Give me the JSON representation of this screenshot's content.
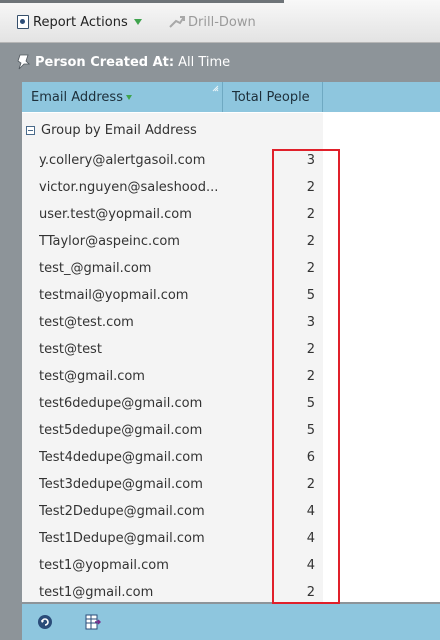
{
  "toolbar": {
    "report_actions_label": "Report Actions",
    "drill_down_label": "Drill-Down"
  },
  "filter": {
    "label": "Person Created At:",
    "value": "All Time"
  },
  "grid": {
    "columns": [
      "Email Address",
      "Total People"
    ],
    "group_label": "Group by Email Address",
    "rows": [
      {
        "email": "y.collery@alertgasoil.com",
        "total": "3"
      },
      {
        "email": "victor.nguyen@saleshood....",
        "total": "2"
      },
      {
        "email": "user.test@yopmail.com",
        "total": "2"
      },
      {
        "email": "TTaylor@aspeinc.com",
        "total": "2"
      },
      {
        "email": "test_@gmail.com",
        "total": "2"
      },
      {
        "email": "testmail@yopmail.com",
        "total": "5"
      },
      {
        "email": "test@test.com",
        "total": "3"
      },
      {
        "email": "test@test",
        "total": "2"
      },
      {
        "email": "test@gmail.com",
        "total": "2"
      },
      {
        "email": "test6dedupe@gmail.com",
        "total": "5"
      },
      {
        "email": "test5dedupe@gmail.com",
        "total": "5"
      },
      {
        "email": "Test4dedupe@gmail.com",
        "total": "6"
      },
      {
        "email": "Test3dedupe@gmail.com",
        "total": "2"
      },
      {
        "email": "Test2Dedupe@gmail.com",
        "total": "4"
      },
      {
        "email": "Test1Dedupe@gmail.com",
        "total": "4"
      },
      {
        "email": "test1@yopmail.com",
        "total": "4"
      },
      {
        "email": "test1@gmail.com",
        "total": "2"
      }
    ]
  },
  "colors": {
    "header_blue": "#8ec6de",
    "highlight_red": "#e0202a",
    "toolbar_gray": "#8d9499"
  },
  "icons": {
    "report_actions": "report-icon",
    "drill_down": "drill-down-icon",
    "filter": "filter-pin-icon",
    "refresh": "refresh-icon",
    "export": "export-grid-icon"
  }
}
